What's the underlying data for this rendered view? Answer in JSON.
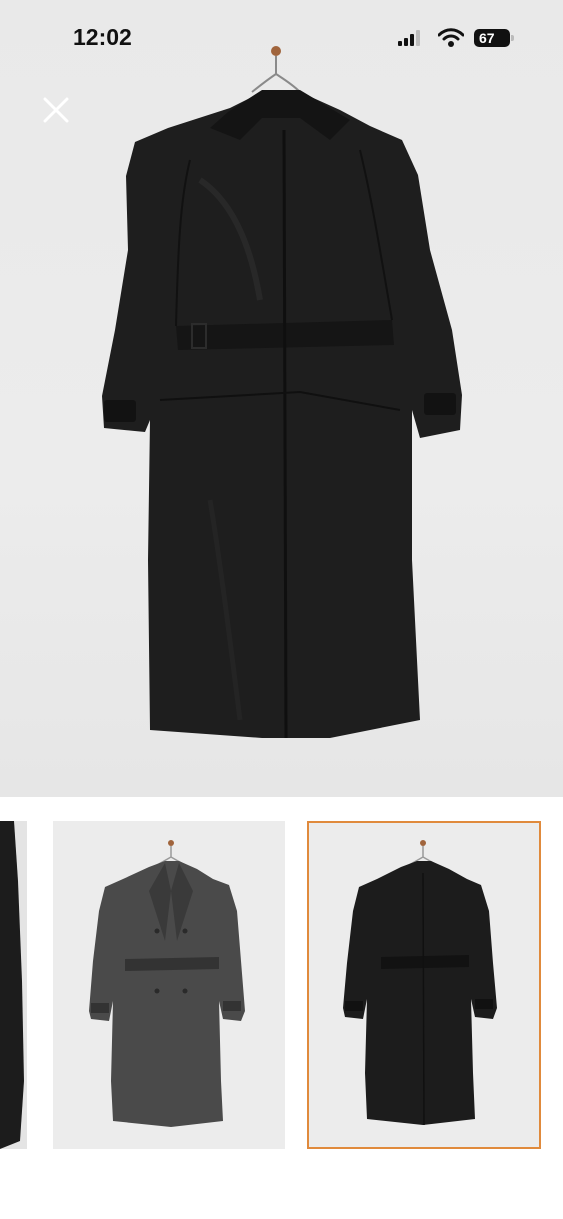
{
  "status_bar": {
    "time": "12:02",
    "battery_level": "67"
  },
  "viewer": {
    "close_icon": "close-icon",
    "main_image_alt": "",
    "selected_thumbnail_index": 2
  },
  "thumbnails": [
    {
      "variant": "partial"
    },
    {
      "variant": "front"
    },
    {
      "variant": "back"
    }
  ],
  "colors": {
    "selected_border": "#e08a3c",
    "coat": "#1b1b1b",
    "background": "#ebebeb"
  }
}
